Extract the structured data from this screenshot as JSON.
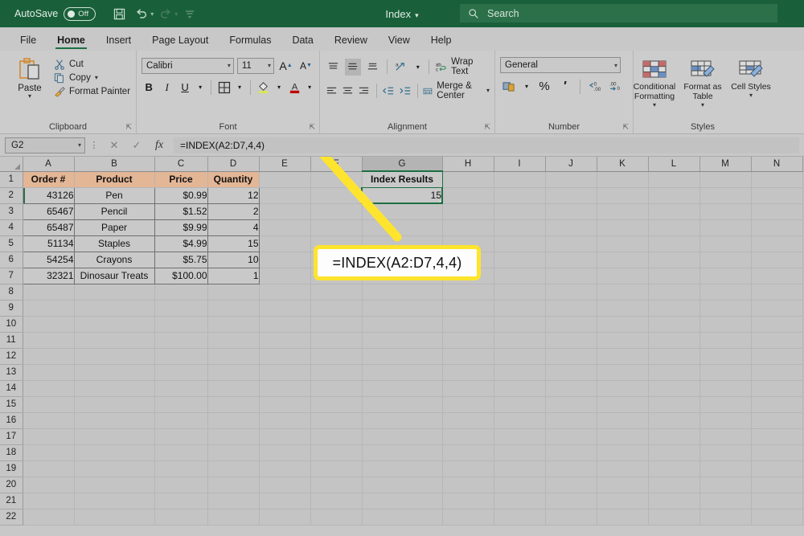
{
  "titlebar": {
    "autosave_label": "AutoSave",
    "autosave_state": "Off",
    "document_title": "Index",
    "title_caret": "▾",
    "qat": [
      {
        "name": "save-icon",
        "glyph": "💾"
      },
      {
        "name": "undo-icon",
        "glyph": "↶"
      },
      {
        "name": "redo-icon",
        "glyph": "↷"
      },
      {
        "name": "customize-qat-icon",
        "glyph": "≡"
      }
    ],
    "search_placeholder": "Search",
    "search_icon": "search-icon"
  },
  "tabs": [
    {
      "label": "File",
      "active": false
    },
    {
      "label": "Home",
      "active": true
    },
    {
      "label": "Insert",
      "active": false
    },
    {
      "label": "Page Layout",
      "active": false
    },
    {
      "label": "Formulas",
      "active": false
    },
    {
      "label": "Data",
      "active": false
    },
    {
      "label": "Review",
      "active": false
    },
    {
      "label": "View",
      "active": false
    },
    {
      "label": "Help",
      "active": false
    }
  ],
  "ribbon": {
    "clipboard": {
      "group_label": "Clipboard",
      "paste_label": "Paste",
      "cut_label": "Cut",
      "copy_label": "Copy",
      "format_painter_label": "Format Painter"
    },
    "font": {
      "group_label": "Font",
      "font_family_value": "Calibri",
      "font_size_value": "11",
      "grow_font": "A",
      "shrink_font": "A",
      "bold": "B",
      "italic": "I",
      "underline": "U"
    },
    "alignment": {
      "group_label": "Alignment",
      "wrap_text_label": "Wrap Text",
      "merge_center_label": "Merge & Center"
    },
    "number": {
      "group_label": "Number",
      "format_value": "General",
      "percent": "%",
      "comma": "′",
      "increase_decimal": ".00",
      "decrease_decimal": ".00"
    },
    "styles": {
      "group_label": "Styles",
      "conditional_formatting": "Conditional Formatting",
      "format_as_table": "Format as Table",
      "cell_styles": "Cell Styles"
    }
  },
  "formula_bar": {
    "name_box_value": "G2",
    "cancel_icon": "✕",
    "enter_icon": "✓",
    "function_icon": "fx",
    "formula_value": "=INDEX(A2:D7,4,4)"
  },
  "callout": {
    "text": "=INDEX(A2:D7,4,4)"
  },
  "sheet": {
    "columns": [
      "A",
      "B",
      "C",
      "D",
      "E",
      "F",
      "G",
      "H",
      "I",
      "J",
      "K",
      "L",
      "M",
      "N"
    ],
    "selected_column": "G",
    "selected_cell": "G2",
    "row_numbers": [
      1,
      2,
      3,
      4,
      5,
      6,
      7,
      8,
      9,
      10,
      11,
      12,
      13,
      14,
      15,
      16,
      17,
      18,
      19,
      20,
      21,
      22
    ],
    "table_headers": [
      "Order #",
      "Product",
      "Price",
      "Quantity"
    ],
    "table_rows": [
      [
        "43126",
        "Pen",
        "$0.99",
        "12"
      ],
      [
        "65467",
        "Pencil",
        "$1.52",
        "2"
      ],
      [
        "65487",
        "Paper",
        "$9.99",
        "4"
      ],
      [
        "51134",
        "Staples",
        "$4.99",
        "15"
      ],
      [
        "54254",
        "Crayons",
        "$5.75",
        "10"
      ],
      [
        "32321",
        "Dinosaur Treats",
        "$100.00",
        "1"
      ]
    ],
    "result_header": "Index Results",
    "result_value": "15"
  },
  "colors": {
    "brand_green": "#19603a",
    "selection_green": "#1d6f43",
    "header_fill": "#e3b696",
    "highlight_yellow": "#ffe42e"
  }
}
